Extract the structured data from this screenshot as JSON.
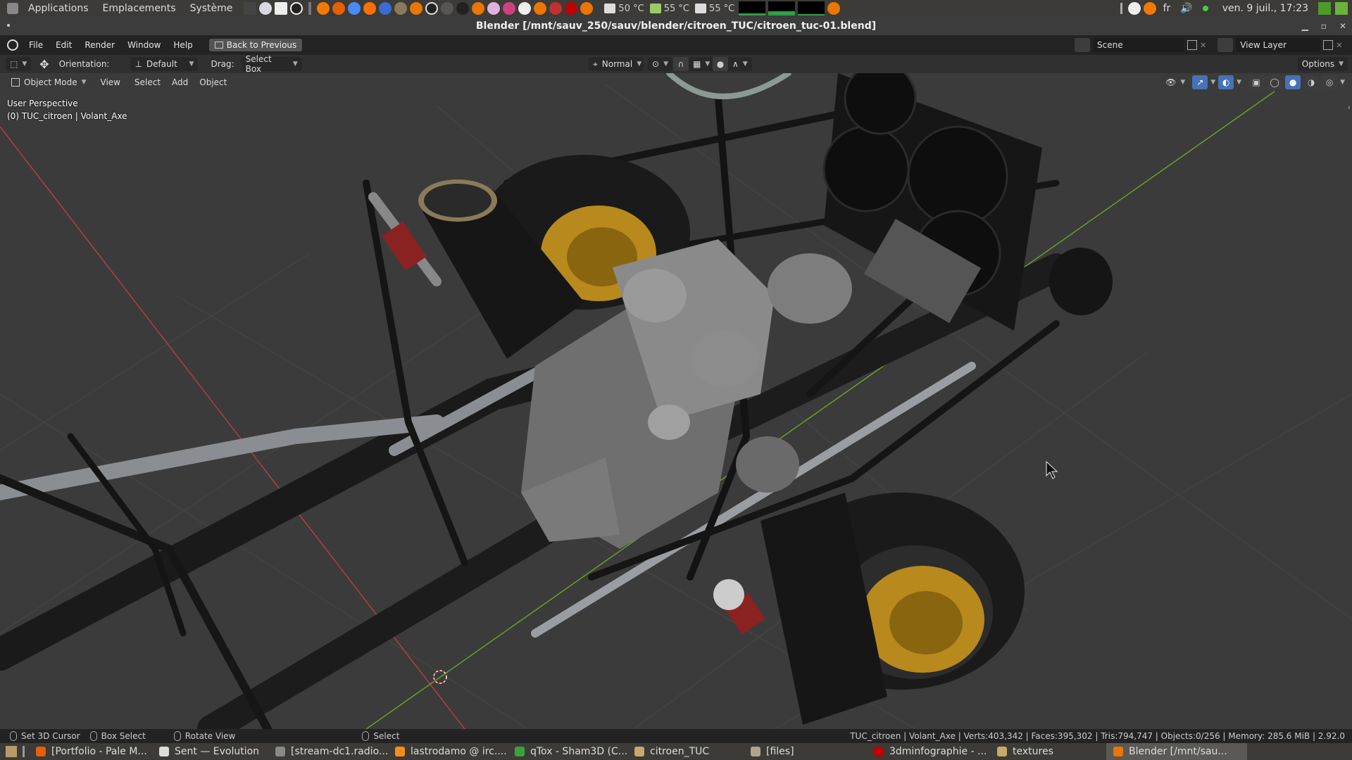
{
  "os_panel": {
    "menus": [
      "Applications",
      "Emplacements",
      "Système"
    ],
    "temps": [
      "50 °C",
      "55 °C",
      "55 °C"
    ],
    "lang": "fr",
    "clock": "ven. 9 juil., 17:23"
  },
  "window": {
    "title": "Blender [/mnt/sauv_250/sauv/blender/citroen_TUC/citroen_tuc-01.blend]"
  },
  "topbar": {
    "menus": [
      "File",
      "Edit",
      "Render",
      "Window",
      "Help"
    ],
    "back_label": "Back to Previous",
    "scene": "Scene",
    "view_layer": "View Layer"
  },
  "toolhead": {
    "orientation_label": "Orientation:",
    "orientation_value": "Default",
    "drag_label": "Drag:",
    "drag_value": "Select Box",
    "pivot_value": "Normal",
    "options_label": "Options"
  },
  "viewhead": {
    "mode": "Object Mode",
    "menus": [
      "View",
      "Select",
      "Add",
      "Object"
    ]
  },
  "viewport": {
    "perspective": "User Perspective",
    "object_info": "(0) TUC_citroen | Volant_Axe"
  },
  "statusbar": {
    "set_cursor": "Set 3D Cursor",
    "box_select": "Box Select",
    "rotate_view": "Rotate View",
    "select": "Select",
    "stats": "TUC_citroen | Volant_Axe | Verts:403,342 | Faces:395,302 | Tris:794,747 | Objects:0/256 | Memory: 285.6 MiB | 2.92.0"
  },
  "taskbar": {
    "tasks": [
      {
        "label": "[Portfolio - Pale M...",
        "color": "#e66000"
      },
      {
        "label": "Sent — Evolution",
        "color": "#dddddd"
      },
      {
        "label": "[stream-dc1.radio...",
        "color": "#888888"
      },
      {
        "label": "lastrodamo @ irc....",
        "color": "#ff8c1a"
      },
      {
        "label": "qTox - Sham3D (C...",
        "color": "#3ca03c"
      },
      {
        "label": "citroen_TUC",
        "color": "#c8a96a"
      },
      {
        "label": "[files]",
        "color": "#b0a48a"
      },
      {
        "label": "3dminfographie - ...",
        "color": "#bf0000"
      },
      {
        "label": "textures",
        "color": "#c8a96a"
      },
      {
        "label": "Blender [/mnt/sau...",
        "color": "#ea7600"
      }
    ]
  },
  "colors": {
    "x_axis": "#b43c48",
    "y_axis": "#6e9b2a",
    "rim_gold": "#b8891c",
    "spring_red": "#8a2222"
  }
}
